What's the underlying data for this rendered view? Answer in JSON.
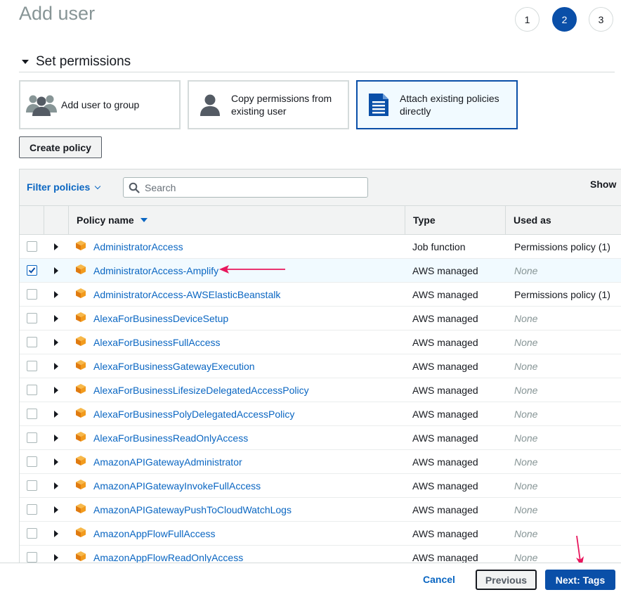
{
  "page": {
    "title": "Add user"
  },
  "steps": [
    "1",
    "2",
    "3"
  ],
  "section": {
    "title": "Set permissions"
  },
  "options": [
    {
      "label": "Add user to group",
      "icon": "user-group-icon"
    },
    {
      "label": "Copy permissions from existing user",
      "icon": "user-icon"
    },
    {
      "label": "Attach existing policies directly",
      "icon": "document-icon"
    }
  ],
  "create_policy": "Create policy",
  "filter": {
    "label": "Filter policies",
    "placeholder": "Search",
    "show_label": "Show"
  },
  "columns": {
    "policy_name": "Policy name",
    "type": "Type",
    "used_as": "Used as"
  },
  "rows": [
    {
      "name": "AdministratorAccess",
      "type": "Job function",
      "used_as": "Permissions policy (1)",
      "checked": false
    },
    {
      "name": "AdministratorAccess-Amplify",
      "type": "AWS managed",
      "used_as": "None",
      "checked": true
    },
    {
      "name": "AdministratorAccess-AWSElasticBeanstalk",
      "type": "AWS managed",
      "used_as": "Permissions policy (1)",
      "checked": false
    },
    {
      "name": "AlexaForBusinessDeviceSetup",
      "type": "AWS managed",
      "used_as": "None",
      "checked": false
    },
    {
      "name": "AlexaForBusinessFullAccess",
      "type": "AWS managed",
      "used_as": "None",
      "checked": false
    },
    {
      "name": "AlexaForBusinessGatewayExecution",
      "type": "AWS managed",
      "used_as": "None",
      "checked": false
    },
    {
      "name": "AlexaForBusinessLifesizeDelegatedAccessPolicy",
      "type": "AWS managed",
      "used_as": "None",
      "checked": false
    },
    {
      "name": "AlexaForBusinessPolyDelegatedAccessPolicy",
      "type": "AWS managed",
      "used_as": "None",
      "checked": false
    },
    {
      "name": "AlexaForBusinessReadOnlyAccess",
      "type": "AWS managed",
      "used_as": "None",
      "checked": false
    },
    {
      "name": "AmazonAPIGatewayAdministrator",
      "type": "AWS managed",
      "used_as": "None",
      "checked": false
    },
    {
      "name": "AmazonAPIGatewayInvokeFullAccess",
      "type": "AWS managed",
      "used_as": "None",
      "checked": false
    },
    {
      "name": "AmazonAPIGatewayPushToCloudWatchLogs",
      "type": "AWS managed",
      "used_as": "None",
      "checked": false
    },
    {
      "name": "AmazonAppFlowFullAccess",
      "type": "AWS managed",
      "used_as": "None",
      "checked": false
    },
    {
      "name": "AmazonAppFlowReadOnlyAccess",
      "type": "AWS managed",
      "used_as": "None",
      "checked": false
    }
  ],
  "footer": {
    "cancel": "Cancel",
    "previous": "Previous",
    "next": "Next: Tags"
  },
  "colors": {
    "accent": "#0a4fa8",
    "link": "#0a66c2",
    "policy_icon": "#f29b1d",
    "annotation_arrow": "#e8175d"
  }
}
